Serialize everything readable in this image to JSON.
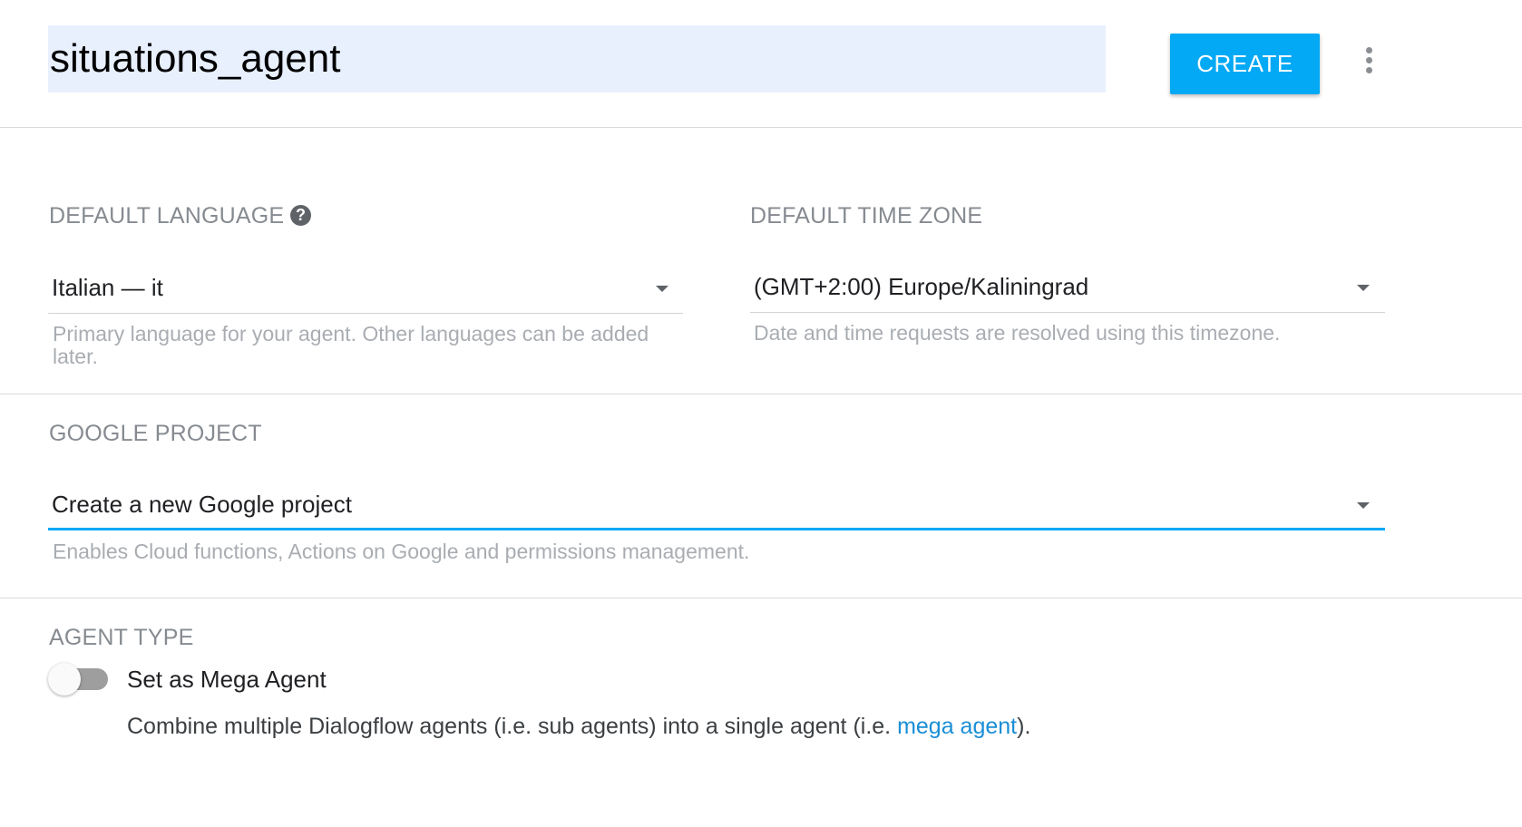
{
  "header": {
    "agent_name": "situations_agent",
    "create_label": "CREATE",
    "more_icon": "more-vert-icon"
  },
  "language": {
    "label": "DEFAULT LANGUAGE",
    "help_icon": "help-icon",
    "selected": "Italian — it",
    "hint": "Primary language for your agent. Other languages can be added later."
  },
  "timezone": {
    "label": "DEFAULT TIME ZONE",
    "selected": "(GMT+2:00) Europe/Kaliningrad",
    "hint": "Date and time requests are resolved using this timezone."
  },
  "project": {
    "label": "GOOGLE PROJECT",
    "selected": "Create a new Google project",
    "hint": "Enables Cloud functions, Actions on Google and permissions management."
  },
  "agent_type": {
    "label": "AGENT TYPE",
    "toggle_label": "Set as Mega Agent",
    "toggle_on": false,
    "desc_before": "Combine multiple Dialogflow agents (i.e. sub agents) into a single agent (i.e. ",
    "desc_link": "mega agent",
    "desc_after": ")."
  },
  "colors": {
    "accent": "#03a9f4",
    "link": "#1a8ed6",
    "name_field_bg": "#e8f0fe"
  }
}
